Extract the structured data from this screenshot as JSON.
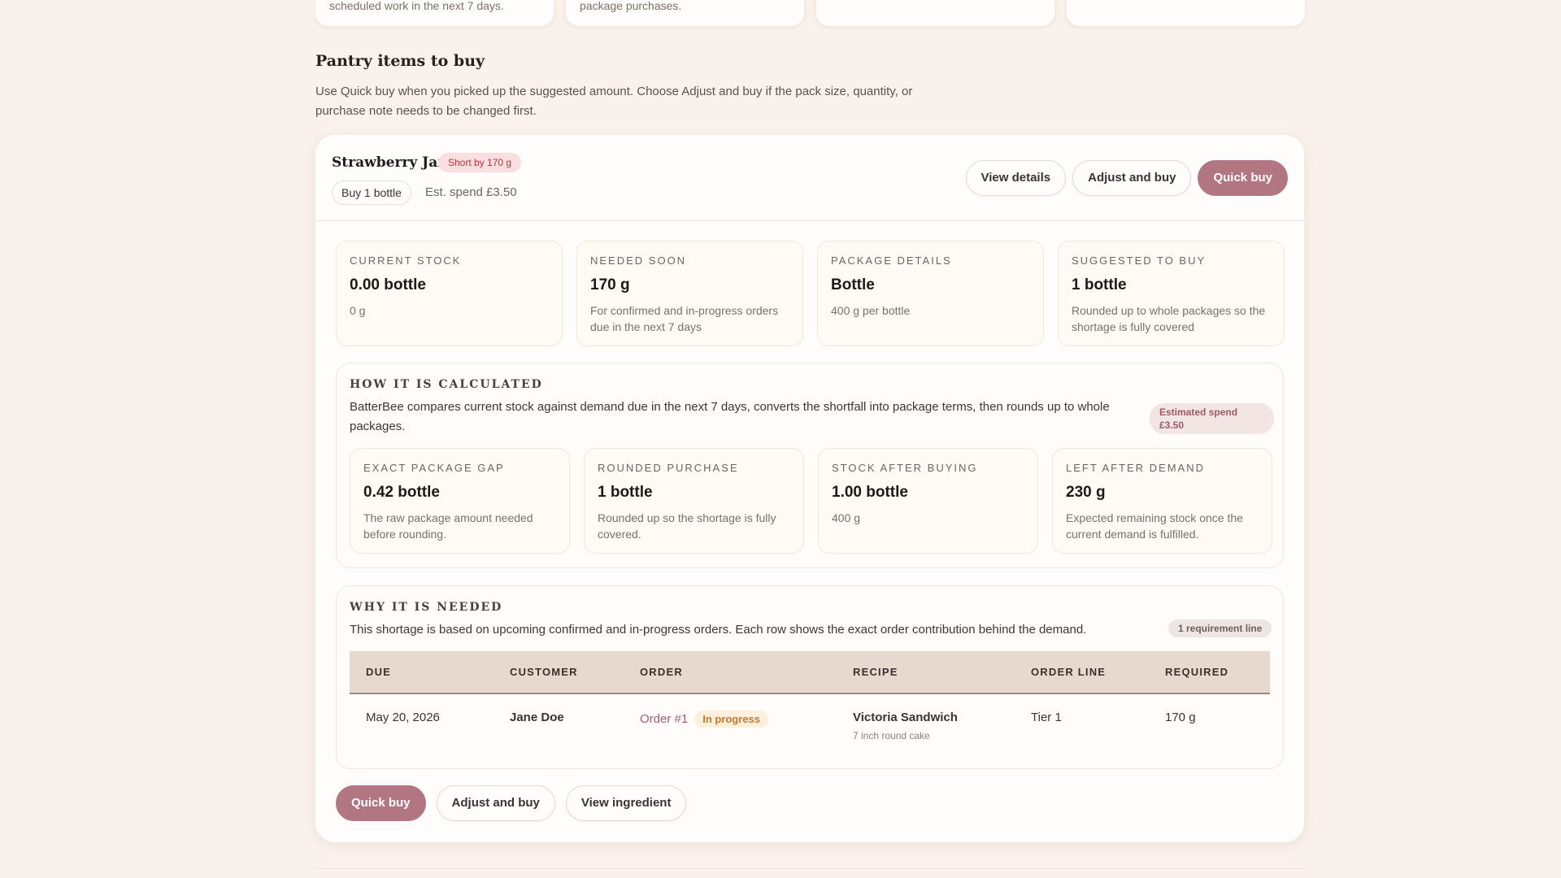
{
  "top_cards": [
    {
      "text": "scheduled work in the next 7 days."
    },
    {
      "text": "package purchases."
    },
    {
      "text": ""
    },
    {
      "text": ""
    }
  ],
  "section": {
    "title": "Pantry items to buy",
    "description": "Use Quick buy when you picked up the suggested amount. Choose Adjust and buy if the pack size, quantity, or purchase note needs to be changed first."
  },
  "item": {
    "name": "Strawberry Jam",
    "short_badge": "Short by 170 g",
    "buy_chip": "Buy 1 bottle",
    "est_spend": "Est. spend £3.50",
    "header_buttons": {
      "view_details": "View details",
      "adjust_and_buy": "Adjust and buy",
      "quick_buy": "Quick buy"
    },
    "stats": [
      {
        "label": "CURRENT STOCK",
        "value": "0.00 bottle",
        "sub": "0 g"
      },
      {
        "label": "NEEDED SOON",
        "value": "170 g",
        "sub": "For confirmed and in-progress orders due in the next 7 days"
      },
      {
        "label": "PACKAGE DETAILS",
        "value": "Bottle",
        "sub": "400 g per bottle"
      },
      {
        "label": "SUGGESTED TO BUY",
        "value": "1 bottle",
        "sub": "Rounded up to whole packages so the shortage is fully covered"
      }
    ],
    "calculation": {
      "title": "HOW IT IS CALCULATED",
      "description": "BatterBee compares current stock against demand due in the next 7 days, converts the shortfall into package terms, then rounds up to whole packages.",
      "spend_pill": "Estimated spend £3.50",
      "stats": [
        {
          "label": "EXACT PACKAGE GAP",
          "value": "0.42 bottle",
          "sub": "The raw package amount needed before rounding."
        },
        {
          "label": "ROUNDED PURCHASE",
          "value": "1 bottle",
          "sub": "Rounded up so the shortage is fully covered."
        },
        {
          "label": "STOCK AFTER BUYING",
          "value": "1.00 bottle",
          "sub": "400 g"
        },
        {
          "label": "LEFT AFTER DEMAND",
          "value": "230 g",
          "sub": "Expected remaining stock once the current demand is fulfilled."
        }
      ]
    },
    "requirements": {
      "title": "WHY IT IS NEEDED",
      "description": "This shortage is based on upcoming confirmed and in-progress orders. Each row shows the exact order contribution behind the demand.",
      "count_pill": "1 requirement line",
      "columns": [
        "DUE",
        "CUSTOMER",
        "ORDER",
        "RECIPE",
        "ORDER LINE",
        "REQUIRED"
      ],
      "rows": [
        {
          "due": "May 20, 2026",
          "customer": "Jane Doe",
          "order": "Order #1",
          "status": "In progress",
          "recipe": "Victoria Sandwich",
          "recipe_sub": "7 inch round cake",
          "order_line": "Tier 1",
          "required": "170 g"
        }
      ]
    },
    "footer_buttons": {
      "quick_buy": "Quick buy",
      "adjust_and_buy": "Adjust and buy",
      "view_ingredient": "View ingredient"
    }
  },
  "colors": {
    "accent": "#b27582",
    "page_bg": "#f9f1ec",
    "short_badge_bg": "#fbdfe0",
    "short_badge_text": "#b8323e",
    "status_pill_text": "#c07a31"
  }
}
